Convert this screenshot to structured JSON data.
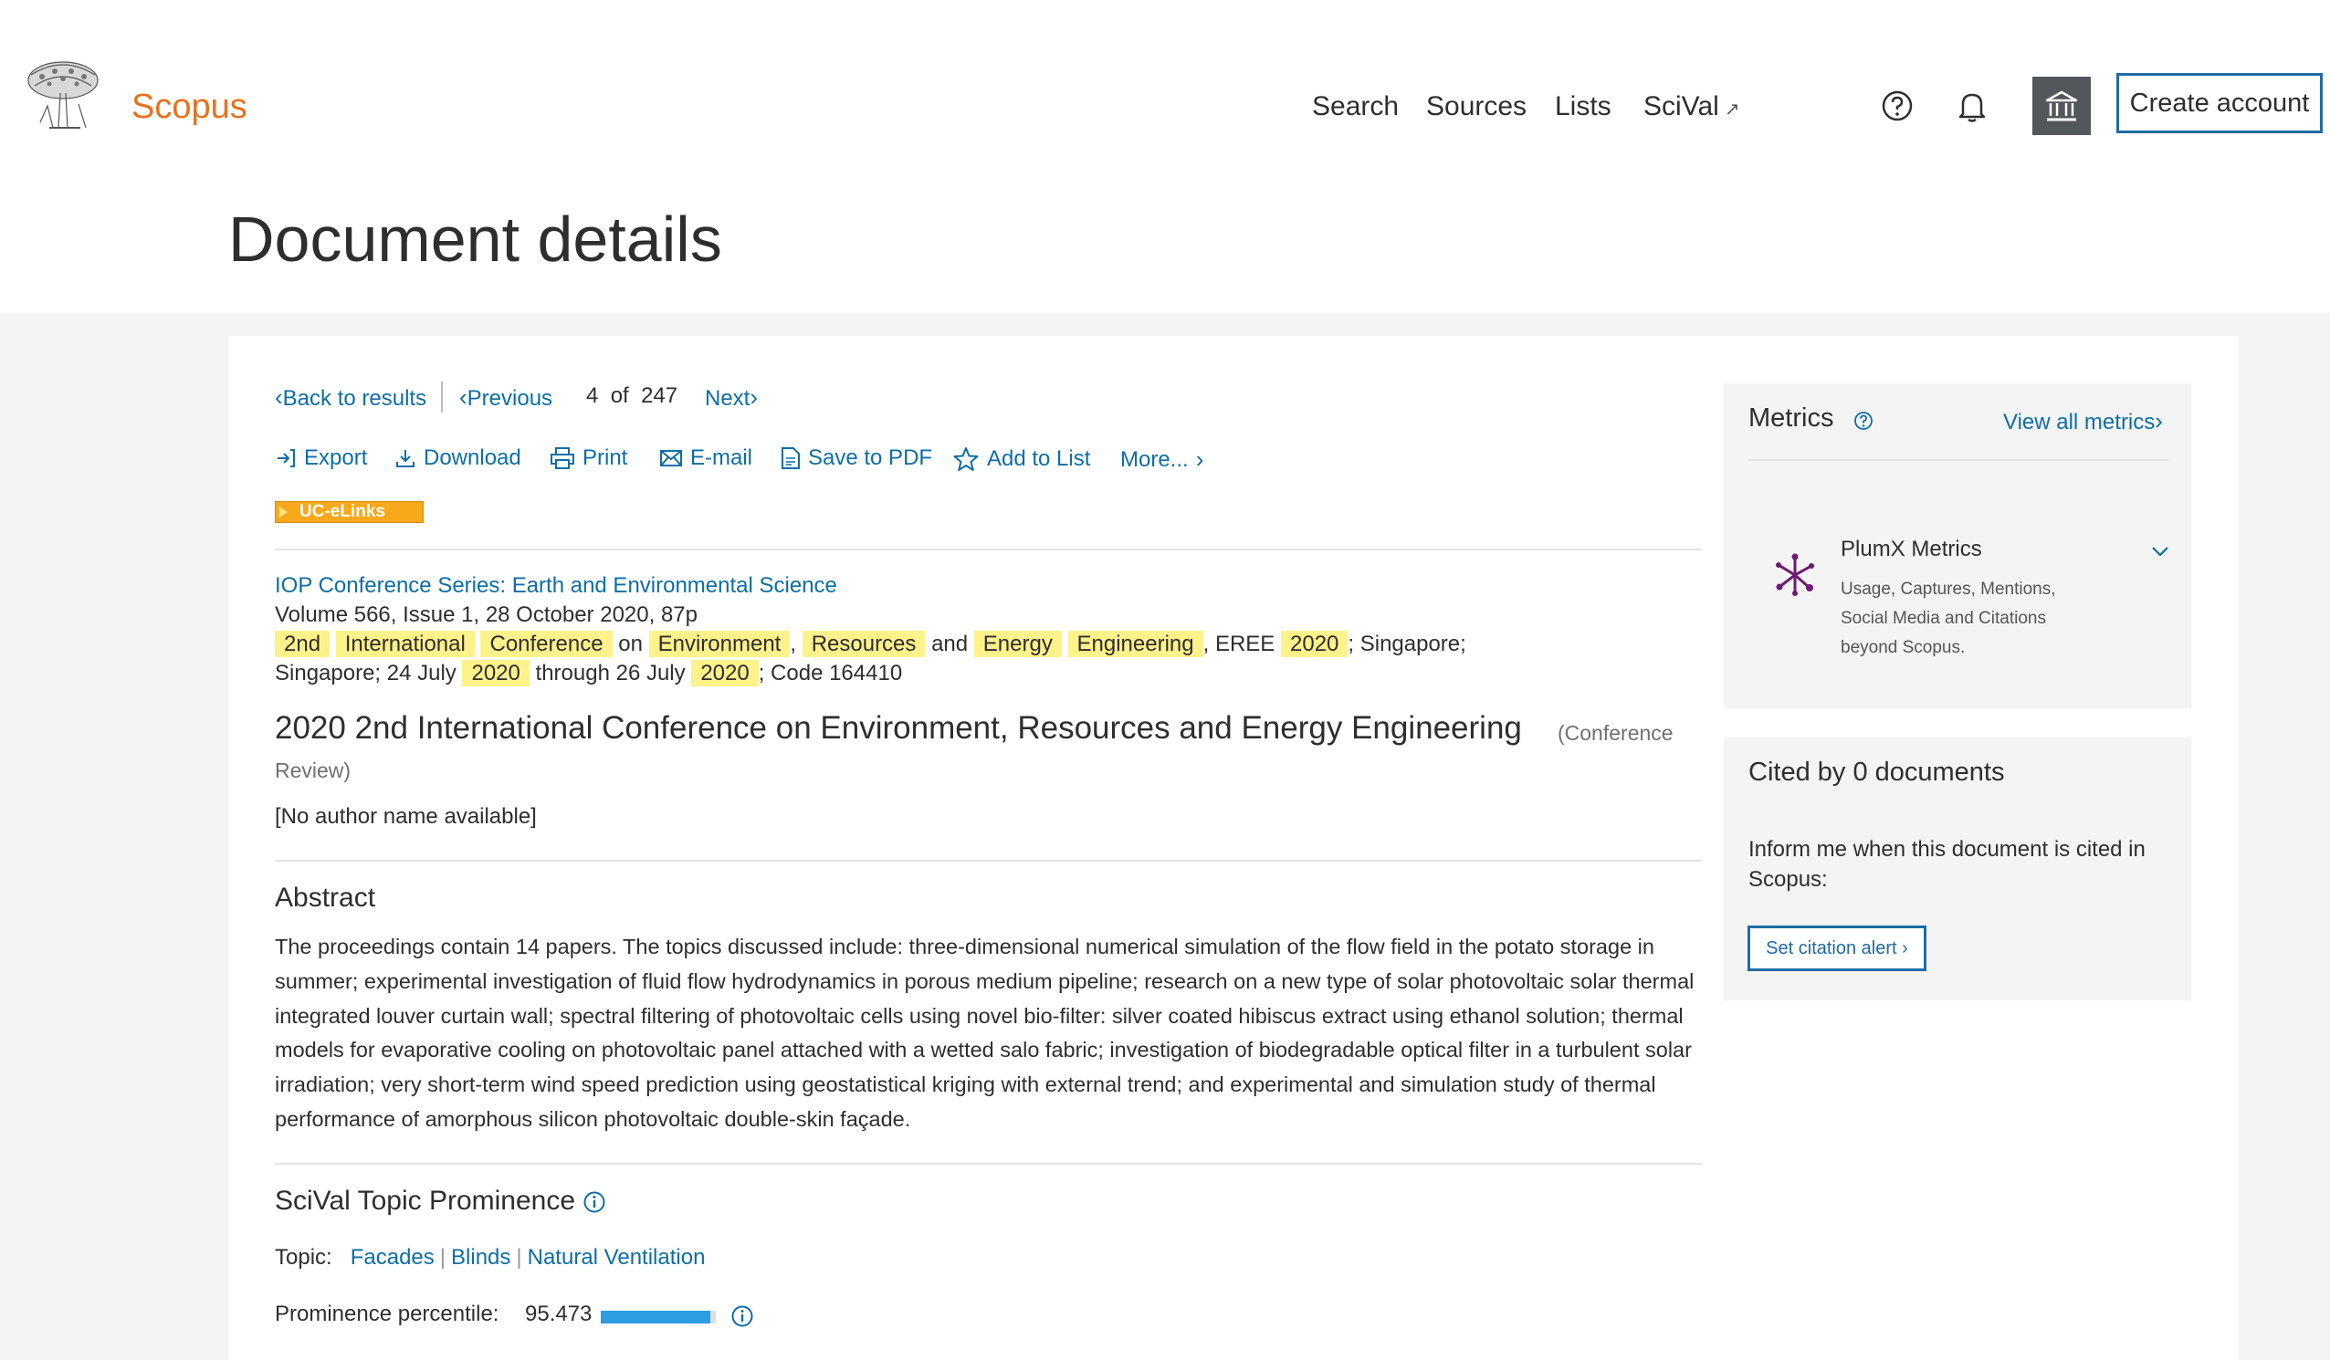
{
  "header": {
    "brand": "Scopus",
    "nav": [
      "Search",
      "Sources",
      "Lists",
      "SciVal"
    ],
    "create_account": "Create account"
  },
  "page_title": "Document details",
  "results_nav": {
    "back": "Back to results",
    "previous": "Previous",
    "position": "4",
    "of": "of",
    "total": "247",
    "next": "Next"
  },
  "toolbar": {
    "export": "Export",
    "download": "Download",
    "print": "Print",
    "email": "E-mail",
    "save_pdf": "Save to PDF",
    "add_to_list": "Add to List",
    "more": "More..."
  },
  "uc_elinks": "UC-eLinks",
  "document": {
    "source": "IOP Conference Series: Earth and Environmental Science",
    "volume": "Volume 566, Issue 1, 28 October 2020, 87p",
    "conf_line1": {
      "w1": "2nd",
      "w2": "International",
      "w3": "Conference",
      "on": "on",
      "w4": "Environment",
      "comma": ",",
      "w5": "Resources",
      "and": "and",
      "w6": "Energy",
      "w7": "Engineering",
      "eree": ", EREE",
      "w8": "2020",
      "tail": "; Singapore;"
    },
    "conf_line2": {
      "start": "Singapore; 24 July",
      "y1": "2020",
      "through": "through 26 July",
      "y2": "2020",
      "code": "; Code 164410"
    },
    "title": "2020 2nd International Conference on Environment, Resources and Energy Engineering",
    "type_part1": "(Conference",
    "type_part2": "Review)",
    "authors": "[No author name available]"
  },
  "abstract": {
    "heading": "Abstract",
    "text": "The proceedings contain 14 papers. The topics discussed include: three-dimensional numerical simulation of the flow field in the potato storage in summer; experimental investigation of fluid flow hydrodynamics in porous medium pipeline; research on a new type of solar photovoltaic solar thermal integrated louver curtain wall; spectral filtering of photovoltaic cells using novel bio-filter: silver coated hibiscus extract using ethanol solution; thermal models for evaporative cooling on photovoltaic panel attached with a wetted salo fabric; investigation of biodegradable optical filter in a turbulent solar irradiation; very short-term wind speed prediction using geostatistical kriging with external trend; and experimental and simulation study of thermal performance of amorphous silicon photovoltaic double-skin façade."
  },
  "scival": {
    "heading": "SciVal Topic Prominence",
    "topic_label": "Topic:",
    "topics": [
      "Facades",
      "Blinds",
      "Natural Ventilation"
    ],
    "prominence_label": "Prominence percentile:",
    "prominence_value": "95.473"
  },
  "metrics": {
    "title": "Metrics",
    "view_all": "View all metrics",
    "plumx_title": "PlumX Metrics",
    "plumx_desc": "Usage, Captures, Mentions, Social Media and Citations beyond Scopus."
  },
  "cited": {
    "title": "Cited by 0 documents",
    "text": "Inform me when this document is cited in Scopus:",
    "button": "Set citation alert"
  },
  "colors": {
    "brand": "#e9711c",
    "link": "#0d6ea5",
    "highlight": "#fef28a",
    "uc_elinks": "#f7a81b",
    "plumx": "#6e1a72"
  }
}
